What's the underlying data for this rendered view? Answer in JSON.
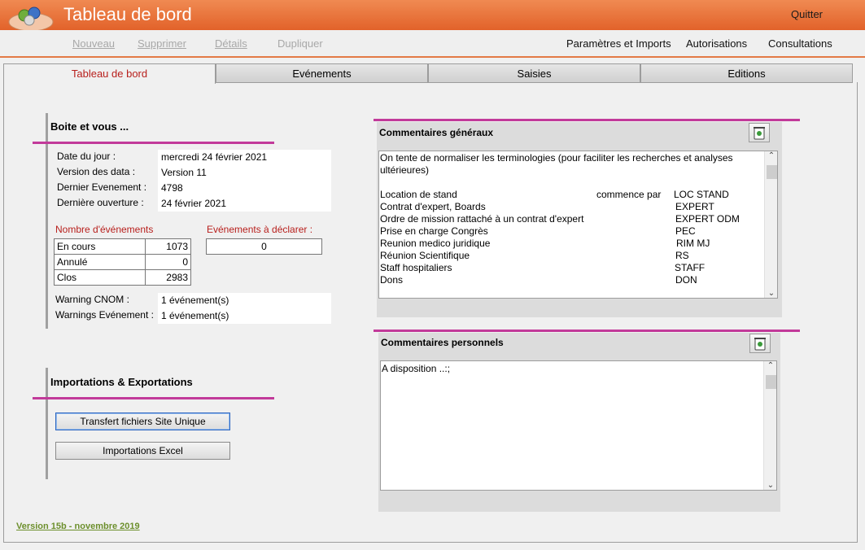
{
  "app": {
    "title": "Tableau de bord",
    "quit_label": "Quitter"
  },
  "menu": {
    "nouveau": "Nouveau",
    "supprimer": "Supprimer",
    "details": "Détails",
    "dupliquer": "Dupliquer",
    "parametres": "Paramètres et Imports",
    "autorisations": "Autorisations",
    "consultations": "Consultations"
  },
  "tabs": [
    "Tableau de bord",
    "Evénements",
    "Saisies",
    "Editions"
  ],
  "boite": {
    "title": "Boite et vous ...",
    "date_label": "Date du jour :",
    "date_value": "mercredi 24 février 2021",
    "version_label": "Version des data  :",
    "version_value": "Version 11",
    "last_event_label": "Dernier Evenement :",
    "last_event_value": "4798",
    "last_open_label": "Dernière ouverture :",
    "last_open_value": "24 février 2021",
    "nb_events_label": "Nombre d'événements",
    "to_declare_label": "Evénements à déclarer :",
    "to_declare_value": "0",
    "counts": [
      {
        "label": "En cours",
        "value": "1073"
      },
      {
        "label": "Annulé",
        "value": "0"
      },
      {
        "label": "Clos",
        "value": "2983"
      }
    ],
    "warning_cnom_label": "Warning CNOM :",
    "warning_cnom_value": "1 événement(s)",
    "warnings_event_label": "Warnings Evénement :",
    "warnings_event_value": "1 événement(s)"
  },
  "imports": {
    "title": "Importations & Exportations",
    "transfer_button": "Transfert fichiers Site Unique",
    "excel_button": "Importations Excel"
  },
  "comments_general": {
    "title": "Commentaires généraux",
    "intro": "On tente de normaliser les terminologies (pour faciliter les recherches et analyses ultérieures)",
    "commence_par": "commence par",
    "rows": [
      {
        "label": "Location de stand",
        "code": "LOC STAND"
      },
      {
        "label": "Contrat d'expert, Boards",
        "code": "EXPERT"
      },
      {
        "label": "Ordre de mission rattaché à un contrat d'expert",
        "code": "EXPERT ODM"
      },
      {
        "label": "Prise en charge Congrès",
        "code": "PEC"
      },
      {
        "label": "Reunion medico juridique",
        "code": "RIM MJ"
      },
      {
        "label": "Réunion Scientifique",
        "code": "RS"
      },
      {
        "label": "Staff hospitaliers",
        "code": "STAFF"
      },
      {
        "label": "Dons",
        "code": "DON"
      }
    ]
  },
  "comments_personal": {
    "title": "Commentaires personnels",
    "text": "A disposition ..:;"
  },
  "footer": {
    "version": "Version 15b - novembre 2019"
  },
  "icons": {
    "logo": "app-logo-icon",
    "trash": "trash-icon"
  },
  "colors": {
    "titlebar": "#e6682f",
    "accent_pink": "#c23a9a",
    "label_red": "#b8201d",
    "link_green": "#6c8f2c"
  }
}
